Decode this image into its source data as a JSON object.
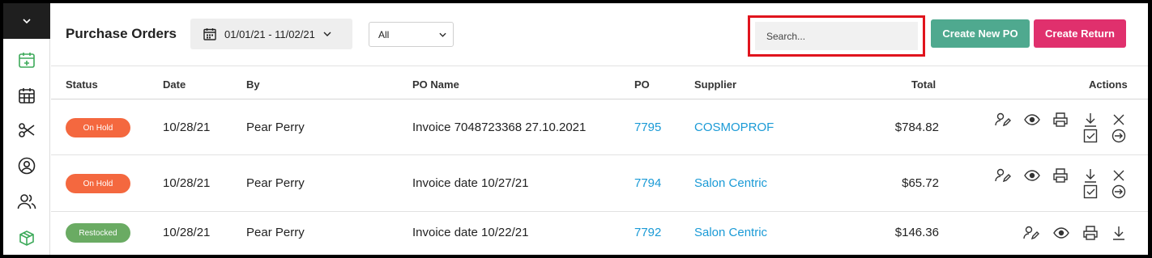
{
  "header": {
    "title": "Purchase Orders",
    "date_range": "01/01/21 - 11/02/21",
    "status_filter": "All",
    "search_placeholder": "Search...",
    "create_po_label": "Create New PO",
    "create_return_label": "Create Return"
  },
  "sidebar": {
    "items": [
      {
        "icon": "calendar-add-icon",
        "active": true
      },
      {
        "icon": "calendar-grid-icon"
      },
      {
        "icon": "scissors-icon"
      },
      {
        "icon": "user-circle-icon"
      },
      {
        "icon": "users-icon"
      },
      {
        "icon": "box-icon",
        "active": true
      }
    ]
  },
  "table": {
    "columns": {
      "status": "Status",
      "date": "Date",
      "by": "By",
      "po_name": "PO Name",
      "po": "PO",
      "supplier": "Supplier",
      "total": "Total",
      "actions": "Actions"
    },
    "rows": [
      {
        "status": "On Hold",
        "date": "10/28/21",
        "by": "Pear Perry",
        "po_name": "Invoice 7048723368 27.10.2021",
        "po": "7795",
        "supplier": "COSMOPROF",
        "total": "$784.82"
      },
      {
        "status": "On Hold",
        "date": "10/28/21",
        "by": "Pear Perry",
        "po_name": "Invoice date 10/27/21",
        "po": "7794",
        "supplier": "Salon Centric",
        "total": "$65.72"
      },
      {
        "status": "Restocked",
        "date": "10/28/21",
        "by": "Pear Perry",
        "po_name": "Invoice date 10/22/21",
        "po": "7792",
        "supplier": "Salon Centric",
        "total": "$146.36"
      }
    ]
  },
  "colors": {
    "on_hold": "#f4683f",
    "restocked": "#6aab63",
    "link": "#1a9ad6",
    "create_po": "#4fa98f",
    "create_return": "#e0306d",
    "highlight": "#e0141d"
  }
}
